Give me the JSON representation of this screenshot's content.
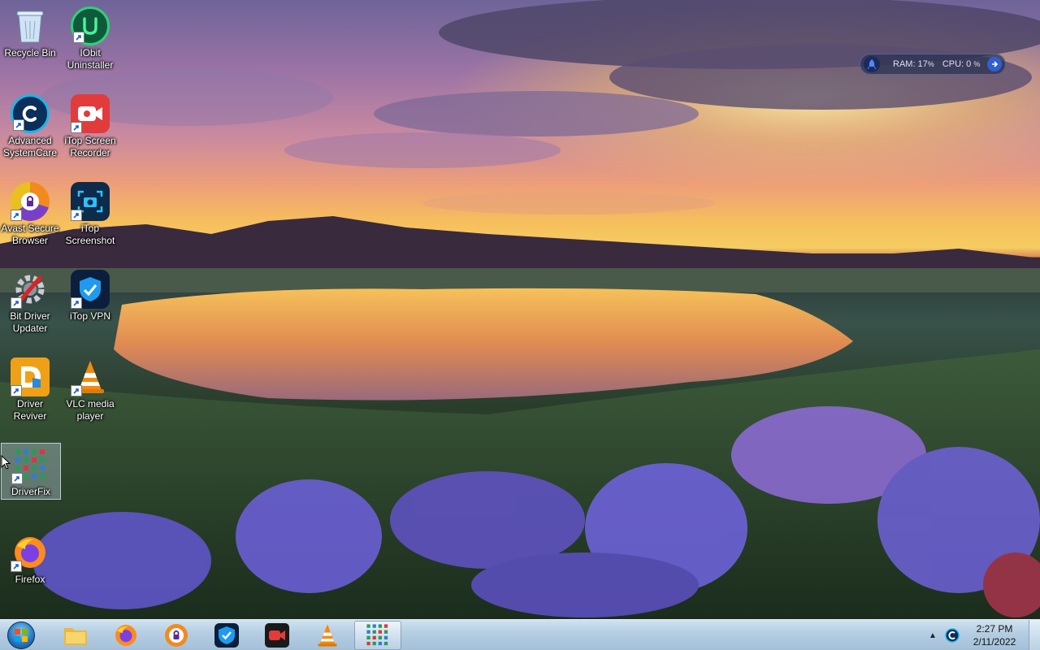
{
  "desktop": {
    "icons": [
      {
        "label": "Recycle Bin",
        "icon": "recycle-bin-icon",
        "shortcut": false
      },
      {
        "label": "IObit\nUninstaller",
        "icon": "iobit-uninstaller-icon",
        "shortcut": true
      },
      {
        "label": "Advanced\nSystemCare",
        "icon": "advanced-systemcare-icon",
        "shortcut": true
      },
      {
        "label": "iTop Screen\nRecorder",
        "icon": "itop-screen-recorder-icon",
        "shortcut": true
      },
      {
        "label": "Avast Secure\nBrowser",
        "icon": "avast-secure-browser-icon",
        "shortcut": true
      },
      {
        "label": "iTop\nScreenshot",
        "icon": "itop-screenshot-icon",
        "shortcut": true
      },
      {
        "label": "Bit Driver\nUpdater",
        "icon": "bit-driver-updater-icon",
        "shortcut": true
      },
      {
        "label": "iTop VPN",
        "icon": "itop-vpn-icon",
        "shortcut": true
      },
      {
        "label": "Driver\nReviver",
        "icon": "driver-reviver-icon",
        "shortcut": true
      },
      {
        "label": "VLC media\nplayer",
        "icon": "vlc-icon",
        "shortcut": true
      },
      {
        "label": "DriverFix",
        "icon": "driverfix-icon",
        "shortcut": true,
        "selected": true
      },
      {
        "label": "Firefox",
        "icon": "firefox-icon",
        "shortcut": true
      }
    ]
  },
  "widget": {
    "ram_label": "RAM: 17",
    "cpu_label": "CPU: 0",
    "percent_sign": "%"
  },
  "taskbar": {
    "apps": [
      {
        "name": "file-explorer",
        "icon": "folder-icon"
      },
      {
        "name": "firefox",
        "icon": "firefox-icon"
      },
      {
        "name": "avast-secure-browser",
        "icon": "avast-secure-browser-icon"
      },
      {
        "name": "itop-vpn",
        "icon": "itop-vpn-icon"
      },
      {
        "name": "itop-screen-recorder",
        "icon": "itop-screen-recorder-icon"
      },
      {
        "name": "vlc",
        "icon": "vlc-icon"
      },
      {
        "name": "driverfix",
        "icon": "driverfix-icon",
        "active": true
      }
    ],
    "tray": {
      "chevron": "▲",
      "icon": "advanced-systemcare-tray-icon"
    },
    "clock": {
      "time": "2:27 PM",
      "date": "2/11/2022"
    }
  },
  "colors": {
    "taskbar_top": "#cfe2f0",
    "taskbar_bottom": "#a4c0d8",
    "icon_label": "#ffffff",
    "selection": "rgba(200,220,240,0.35)"
  }
}
